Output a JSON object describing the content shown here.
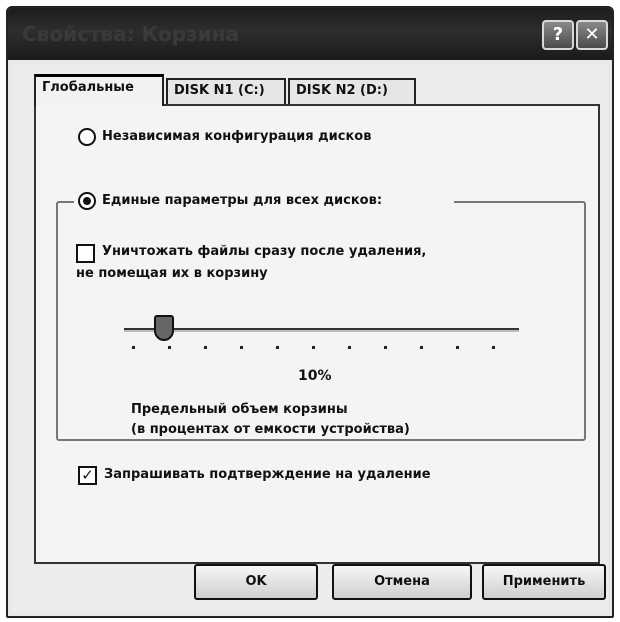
{
  "window": {
    "title": "Свойства: Корзина",
    "help_glyph": "?",
    "close_glyph": "✕"
  },
  "tabs": [
    {
      "label": "Глобальные",
      "active": true
    },
    {
      "label": "DISK N1 (C:)",
      "active": false
    },
    {
      "label": "DISK N2 (D:)",
      "active": false
    }
  ],
  "options": {
    "independent_label": "Независимая конфигурация дисков",
    "independent_selected": false,
    "uniform_label": "Единые параметры для всех дисков:",
    "uniform_selected": true
  },
  "group": {
    "delete_immediately_label_line1": "Уничтожать файлы сразу после удаления,",
    "delete_immediately_label_line2": "не помещая их в корзину",
    "delete_immediately_checked": false,
    "slider_value_text": "10%",
    "slider_value": 10,
    "max_size_label_line1": "Предельный объем корзины",
    "max_size_label_line2": "(в процентах от емкости устройства)"
  },
  "confirm": {
    "label": "Запрашивать подтверждение на удаление",
    "checked": true,
    "check_glyph": "✓"
  },
  "buttons": {
    "ok": "OK",
    "cancel": "Отмена",
    "apply": "Применить"
  }
}
